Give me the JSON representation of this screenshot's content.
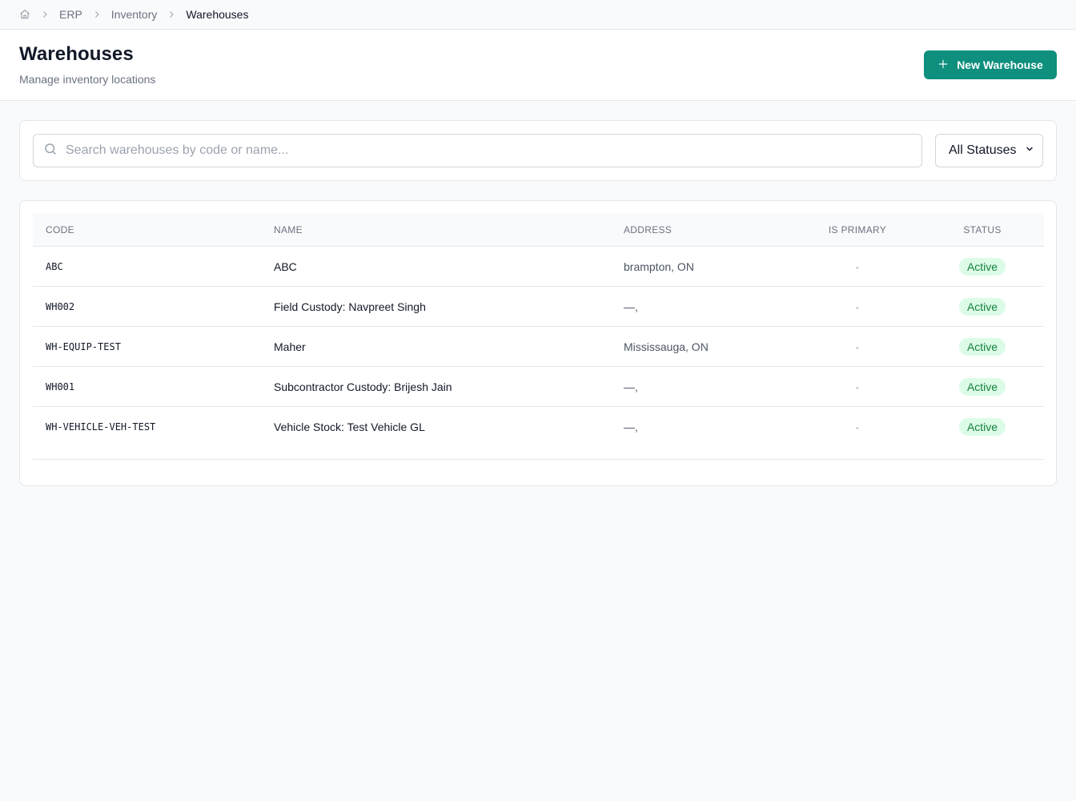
{
  "breadcrumb": {
    "items": [
      "ERP",
      "Inventory",
      "Warehouses"
    ]
  },
  "header": {
    "title": "Warehouses",
    "subtitle": "Manage inventory locations",
    "new_button_label": "New Warehouse"
  },
  "filters": {
    "search_placeholder": "Search warehouses by code or name...",
    "search_value": "",
    "status_selected": "All Statuses"
  },
  "table": {
    "columns": [
      "CODE",
      "NAME",
      "ADDRESS",
      "IS PRIMARY",
      "STATUS"
    ],
    "rows": [
      {
        "code": "ABC",
        "name": "ABC",
        "address": "brampton, ON",
        "is_primary": "-",
        "status": "Active"
      },
      {
        "code": "WH002",
        "name": "Field Custody: Navpreet Singh",
        "address": "—,",
        "is_primary": "-",
        "status": "Active"
      },
      {
        "code": "WH-EQUIP-TEST",
        "name": "Maher",
        "address": "Mississauga, ON",
        "is_primary": "-",
        "status": "Active"
      },
      {
        "code": "WH001",
        "name": "Subcontractor Custody: Brijesh Jain",
        "address": "—,",
        "is_primary": "-",
        "status": "Active"
      },
      {
        "code": "WH-VEHICLE-VEH-TEST",
        "name": "Vehicle Stock: Test Vehicle GL",
        "address": "—,",
        "is_primary": "-",
        "status": "Active"
      }
    ]
  },
  "colors": {
    "accent": "#0f8f7e",
    "active_badge_bg": "#dcfce7",
    "active_badge_text": "#15803d"
  },
  "icons": {
    "home": "home-icon",
    "separator": "chevron-right-icon",
    "add": "plus-icon",
    "search": "search-icon",
    "select": "chevron-down-icon"
  }
}
